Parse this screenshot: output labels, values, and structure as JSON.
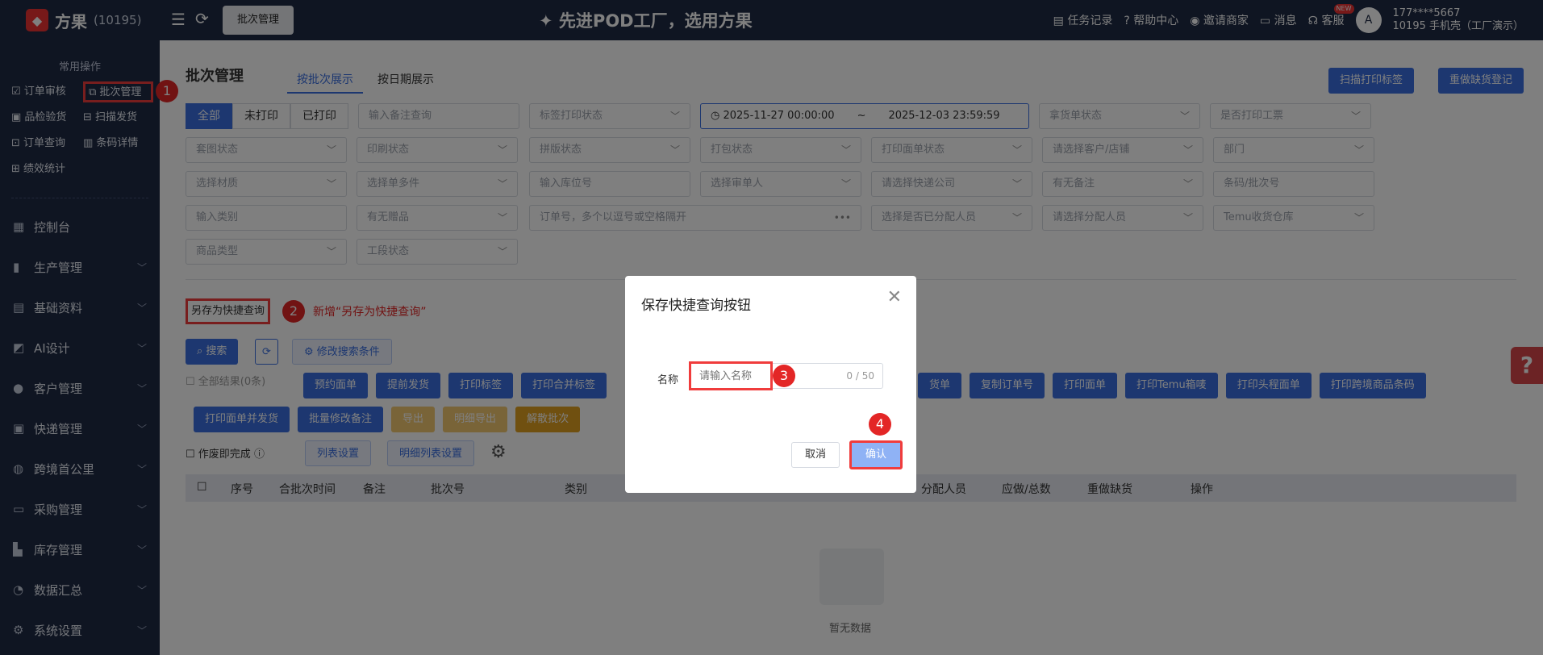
{
  "sidebar": {
    "logo_text": "方果",
    "logo_id": "(10195)",
    "common_title": "常用操作",
    "quick": [
      "订单审核",
      "批次管理",
      "品检验货",
      "扫描发货",
      "订单查询",
      "条码详情",
      "绩效统计"
    ],
    "menu": [
      "控制台",
      "生产管理",
      "基础资料",
      "AI设计",
      "客户管理",
      "快递管理",
      "跨境首公里",
      "采购管理",
      "库存管理",
      "数据汇总",
      "系统设置"
    ]
  },
  "topbar": {
    "active_tab": "批次管理",
    "slogan": "先进POD工厂，选用方果",
    "links": [
      "任务记录",
      "帮助中心",
      "邀请商家",
      "消息",
      "客服"
    ],
    "new_badge": "NEW",
    "user_phone": "177****5667",
    "user_sub": "10195 手机壳（工厂演示）"
  },
  "page": {
    "title": "批次管理",
    "tabs": [
      "按批次展示",
      "按日期展示"
    ],
    "top_buttons": [
      "扫描打印标签",
      "重做缺货登记"
    ],
    "seg": [
      "全部",
      "未打印",
      "已打印"
    ],
    "date_start": "2025-11-27 00:00:00",
    "date_sep": "~",
    "date_end": "2025-12-03 23:59:59",
    "fields": [
      "输入备注查询",
      "标签打印状态",
      "拿货单状态",
      "是否打印工票",
      "套图状态",
      "印刷状态",
      "拼版状态",
      "打包状态",
      "打印面单状态",
      "请选择客户/店铺",
      "部门",
      "选择材质",
      "选择单多件",
      "输入库位号",
      "选择审单人",
      "请选择快递公司",
      "有无备注",
      "条码/批次号",
      "输入类别",
      "有无赠品",
      "订单号，多个以逗号或空格隔开",
      "选择是否已分配人员",
      "请选择分配人员",
      "Temu收货仓库",
      "商品类型",
      "工段状态"
    ],
    "save_quick": "另存为快捷查询",
    "save_note": "新增“另存为快捷查询”",
    "search": "搜索",
    "modify_search": "修改搜索条件",
    "all_results": "全部结果(0条)",
    "actions1": [
      "预约面单",
      "提前发货",
      "打印标签",
      "打印合并标签",
      "货单",
      "复制订单号",
      "打印面单",
      "打印Temu箱唛",
      "打印头程面单",
      "打印跨境商品条码"
    ],
    "actions2": [
      "打印面单并发货",
      "批量修改备注",
      "导出",
      "明细导出",
      "解散批次"
    ],
    "void_done": "作废即完成",
    "list_settings": "列表设置",
    "detail_settings": "明细列表设置",
    "columns": [
      "序号",
      "合批次时间",
      "备注",
      "批次号",
      "类别",
      "分配人员",
      "应做/总数",
      "重做缺货",
      "操作"
    ],
    "empty": "暂无数据"
  },
  "modal": {
    "title": "保存快捷查询按钮",
    "name_label": "名称",
    "name_placeholder": "请输入名称",
    "counter": "0 / 50",
    "cancel": "取消",
    "confirm": "确认"
  },
  "badges": [
    "1",
    "2",
    "3",
    "4"
  ]
}
